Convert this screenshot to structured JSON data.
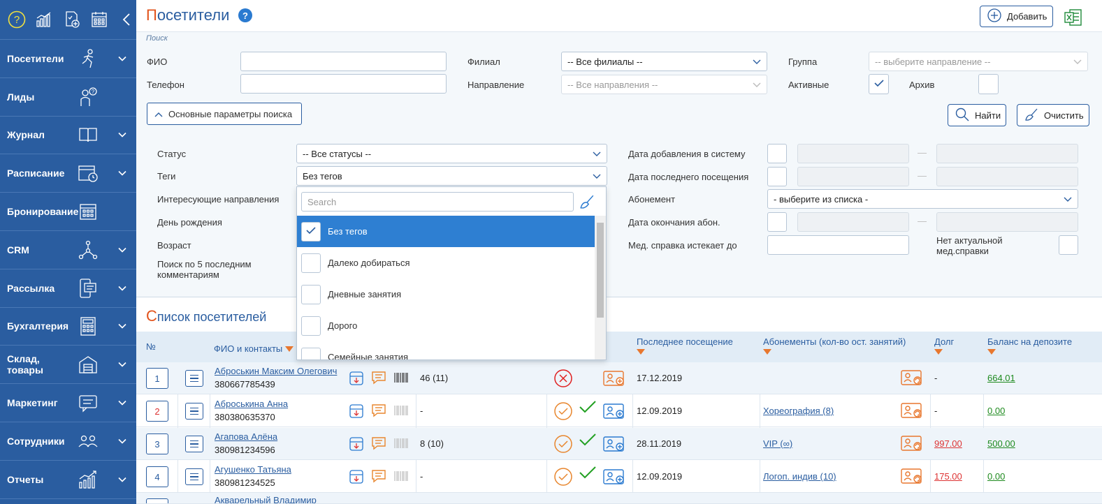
{
  "sidebar": {
    "items": [
      {
        "label": "Посетители",
        "icon": "runner-icon"
      },
      {
        "label": "Лиды",
        "icon": "person-question-icon"
      },
      {
        "label": "Журнал",
        "icon": "book-icon"
      },
      {
        "label": "Расписание",
        "icon": "calendar-clock-icon"
      },
      {
        "label": "Бронирование",
        "icon": "calendar-grid-icon"
      },
      {
        "label": "CRM",
        "icon": "network-icon"
      },
      {
        "label": "Рассылка",
        "icon": "mobile-message-icon"
      },
      {
        "label": "Бухгалтерия",
        "icon": "calculator-icon"
      },
      {
        "label": "Склад, товары",
        "icon": "warehouse-icon"
      },
      {
        "label": "Маркетинг",
        "icon": "chat-icon"
      },
      {
        "label": "Сотрудники",
        "icon": "people-icon"
      },
      {
        "label": "Отчеты",
        "icon": "growth-chart-icon"
      }
    ]
  },
  "header": {
    "title_first": "П",
    "title_rest": "осетители",
    "help": "?",
    "add_label": "Добавить"
  },
  "search": {
    "caption": "Поиск",
    "fio_label": "ФИО",
    "phone_label": "Телефон",
    "branch_label": "Филиал",
    "branch_value": "-- Все филиалы --",
    "direction_label": "Направление",
    "direction_value": "-- Все направления --",
    "group_label": "Группа",
    "group_value": "-- выберите направление --",
    "active_label": "Активные",
    "archive_label": "Архив",
    "params_label": "Основные параметры поиска",
    "find_label": "Найти",
    "clear_label": "Очистить",
    "status_label": "Статус",
    "status_value": "-- Все статусы --",
    "tags_label": "Теги",
    "tags_value": "Без тегов",
    "interest_label": "Интересующие направления",
    "birthday_label": "День рождения",
    "age_label": "Возраст",
    "comments_label_1": "Поиск по 5 последним",
    "comments_label_2": "комментариям",
    "date_added_label": "Дата добавления в систему",
    "last_visit_label": "Дата последнего посещения",
    "subscription_label": "Абонемент",
    "subscription_value": "- выберите из списка -",
    "sub_end_label": "Дата окончания абон.",
    "med_label": "Мед. справка истекает до",
    "no_med_label_1": "Нет актуальной",
    "no_med_label_2": "мед.справки",
    "dash": "—"
  },
  "dropdown": {
    "placeholder": "Search",
    "options": [
      {
        "label": "Без тегов",
        "checked": true
      },
      {
        "label": "Далеко добираться",
        "checked": false
      },
      {
        "label": "Дневные занятия",
        "checked": false
      },
      {
        "label": "Дорого",
        "checked": false
      },
      {
        "label": "Семейные занятия",
        "checked": false
      }
    ]
  },
  "list": {
    "title_first": "С",
    "title_rest": "писок посетителей",
    "columns": {
      "num": "№",
      "fio": "ФИО и контакты",
      "last_visit": "Последнее посещение",
      "subs": "Абонементы (кол-во ост. занятий)",
      "debt": "Долг",
      "balance": "Баланс на депозите"
    },
    "rows": [
      {
        "num": "1",
        "name": "Аброськин Максим Олегович",
        "phone": "380667785439",
        "visits": "46 (11)",
        "last_visit": "17.12.2019",
        "subs": "",
        "debt": "-",
        "balance": "664.01"
      },
      {
        "num": "2",
        "name": "Аброськина Анна",
        "phone": "380380635370",
        "visits": "-",
        "last_visit": "12.09.2019",
        "subs": "Хореография (8)",
        "debt": "-",
        "balance": "0.00"
      },
      {
        "num": "3",
        "name": "Агапова Алёна",
        "phone": "380981234596",
        "visits": "8 (10)",
        "last_visit": "28.11.2019",
        "subs": "VIP (∞)",
        "debt": "997.00",
        "balance": "500.00"
      },
      {
        "num": "4",
        "name": "Агушенко Татьяна",
        "phone": "380981234525",
        "visits": "-",
        "last_visit": "12.09.2019",
        "subs": "Логоп. индив (10)",
        "debt": "175.00",
        "balance": "0.00"
      },
      {
        "num": "",
        "name": "Акварельный Владимир",
        "phone": "",
        "visits": "",
        "last_visit": "",
        "subs": "",
        "debt": "",
        "balance": ""
      }
    ]
  },
  "colors": {
    "sidebar": "#2a5da0",
    "accent": "#e2531c",
    "selected": "#2e7fd2",
    "debt": "#d33333",
    "balance": "#1e8a1e"
  }
}
